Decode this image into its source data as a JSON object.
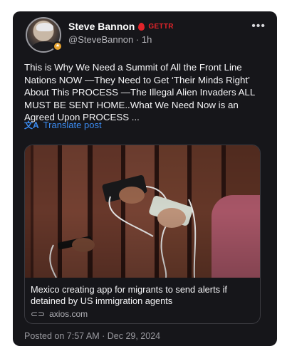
{
  "post": {
    "author_name": "Steve Bannon",
    "platform_label": "GETTR",
    "handle": "@SteveBannon",
    "separator": "·",
    "time_ago": "1h",
    "text": "This is Why We Need a Summit of All the Front Line Nations NOW  —They Need to Get ‘Their Minds Right’ About This PROCESS —The Illegal Alien Invaders  ALL MUST BE SENT HOME..What We Need Now is an Agreed Upon PROCESS ...",
    "translate_label": "Translate post",
    "posted_on": "Posted on 7:57 AM · Dec 29, 2024"
  },
  "link_preview": {
    "title": "Mexico creating app for migrants to send alerts if detained by US immigration agents",
    "domain": "axios.com"
  },
  "icons": {
    "more": "more-horizontal-icon",
    "translate": "translate-icon",
    "link": "link-icon",
    "platform": "gettr-flame-icon",
    "verified": "verified-badge-icon"
  },
  "colors": {
    "card_bg": "#16161a",
    "accent_link": "#3b8bf0",
    "gettr_red": "#e2242a",
    "badge_gold": "#e7a22e"
  }
}
